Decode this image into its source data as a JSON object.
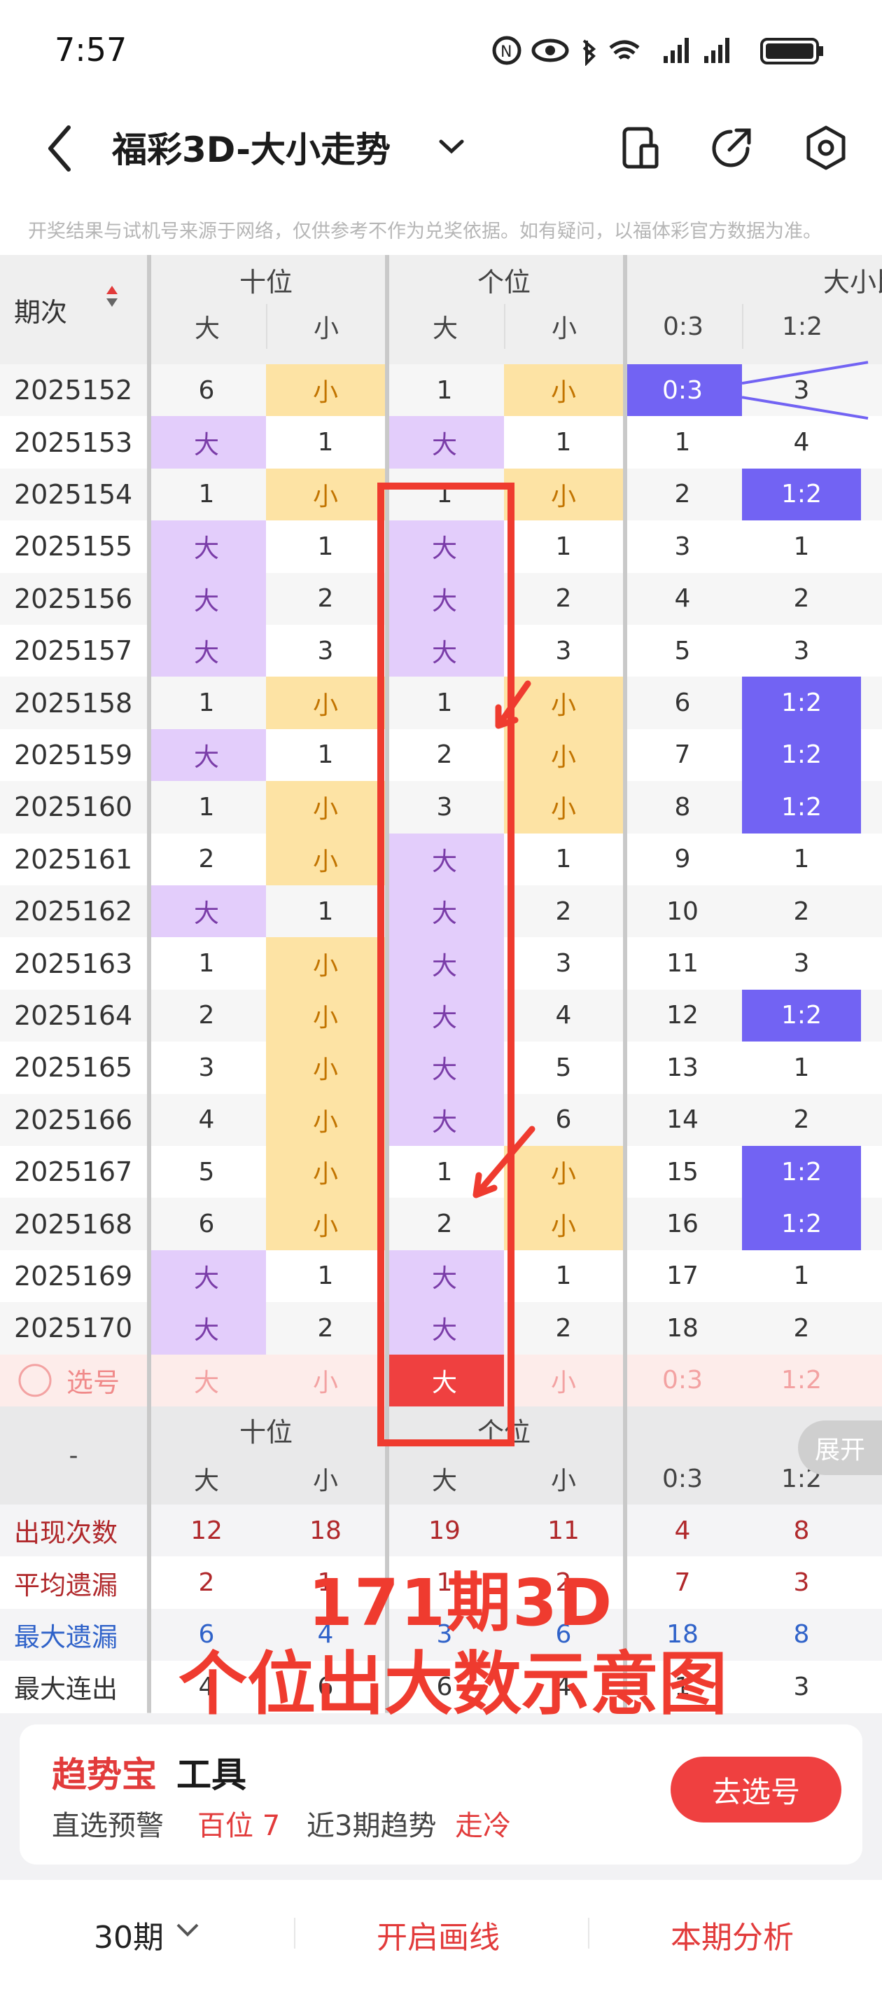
{
  "status_bar": {
    "time": "7:57",
    "icons": [
      "nfc-icon",
      "eye-icon",
      "bluetooth-icon",
      "wifi-icon",
      "signal-icon",
      "signal-icon",
      "battery-icon"
    ]
  },
  "header": {
    "title": "福彩3D-大小走势",
    "icons": [
      "back-icon",
      "chevron-down-icon",
      "phone-screen-icon",
      "share-icon",
      "settings-icon"
    ]
  },
  "disclaimer": "开奖结果与试机号来源于网络，仅供参考不作为兑奖依据。如有疑问，以福体彩官方数据为准。",
  "table": {
    "period_header": "期次",
    "groups": [
      "十位",
      "个位",
      "大小比"
    ],
    "subheaders": [
      "大",
      "小",
      "大",
      "小",
      "0:3",
      "1:2"
    ],
    "rows": [
      {
        "period": "2025152",
        "cells": [
          "6",
          "小",
          "1",
          "小",
          "0:3",
          "3"
        ]
      },
      {
        "period": "2025153",
        "cells": [
          "大",
          "1",
          "大",
          "1",
          "1",
          "4"
        ]
      },
      {
        "period": "2025154",
        "cells": [
          "1",
          "小",
          "1",
          "小",
          "2",
          "1:2"
        ]
      },
      {
        "period": "2025155",
        "cells": [
          "大",
          "1",
          "大",
          "1",
          "3",
          "1"
        ]
      },
      {
        "period": "2025156",
        "cells": [
          "大",
          "2",
          "大",
          "2",
          "4",
          "2"
        ]
      },
      {
        "period": "2025157",
        "cells": [
          "大",
          "3",
          "大",
          "3",
          "5",
          "3"
        ]
      },
      {
        "period": "2025158",
        "cells": [
          "1",
          "小",
          "1",
          "小",
          "6",
          "1:2"
        ]
      },
      {
        "period": "2025159",
        "cells": [
          "大",
          "1",
          "2",
          "小",
          "7",
          "1:2"
        ]
      },
      {
        "period": "2025160",
        "cells": [
          "1",
          "小",
          "3",
          "小",
          "8",
          "1:2"
        ]
      },
      {
        "period": "2025161",
        "cells": [
          "2",
          "小",
          "大",
          "1",
          "9",
          "1"
        ]
      },
      {
        "period": "2025162",
        "cells": [
          "大",
          "1",
          "大",
          "2",
          "10",
          "2"
        ]
      },
      {
        "period": "2025163",
        "cells": [
          "1",
          "小",
          "大",
          "3",
          "11",
          "3"
        ]
      },
      {
        "period": "2025164",
        "cells": [
          "2",
          "小",
          "大",
          "4",
          "12",
          "1:2"
        ]
      },
      {
        "period": "2025165",
        "cells": [
          "3",
          "小",
          "大",
          "5",
          "13",
          "1"
        ]
      },
      {
        "period": "2025166",
        "cells": [
          "4",
          "小",
          "大",
          "6",
          "14",
          "2"
        ]
      },
      {
        "period": "2025167",
        "cells": [
          "5",
          "小",
          "1",
          "小",
          "15",
          "1:2"
        ]
      },
      {
        "period": "2025168",
        "cells": [
          "6",
          "小",
          "2",
          "小",
          "16",
          "1:2"
        ]
      },
      {
        "period": "2025169",
        "cells": [
          "大",
          "1",
          "大",
          "1",
          "17",
          "1"
        ]
      },
      {
        "period": "2025170",
        "cells": [
          "大",
          "2",
          "大",
          "2",
          "18",
          "2"
        ]
      }
    ],
    "select_row": {
      "label": "选号",
      "cells": [
        "大",
        "小",
        "大",
        "小",
        "0:3",
        "1:2"
      ]
    },
    "footer_groups": [
      "十位",
      "个位"
    ],
    "footer_period": "-",
    "stats": [
      {
        "label": "出现次数",
        "values": [
          "12",
          "18",
          "19",
          "11",
          "4",
          "8"
        ],
        "color": "#b0282b"
      },
      {
        "label": "平均遗漏",
        "values": [
          "2",
          "1",
          "1",
          "2",
          "7",
          "3"
        ],
        "color": "#b0282b"
      },
      {
        "label": "最大遗漏",
        "values": [
          "6",
          "4",
          "3",
          "6",
          "18",
          "8"
        ],
        "color": "#2f62c9"
      },
      {
        "label": "最大连出",
        "values": [
          "4",
          "6",
          "6",
          "4",
          "1",
          "3"
        ],
        "color": "#333333"
      }
    ]
  },
  "expand_label": "展开",
  "annotation": {
    "line1": "171期3D",
    "line2": "个位出大数示意图"
  },
  "trend_card": {
    "title_red": "趋势宝",
    "title_black": "工具",
    "line_label1": "直选预警",
    "line_value1": "百位 7",
    "line_label2": "近3期趋势",
    "line_value2": "走冷",
    "button": "去选号"
  },
  "bottom_nav": {
    "periods": "30期",
    "draw_line": "开启画线",
    "analysis": "本期分析"
  },
  "colors": {
    "big_bg": "#e3cdfb",
    "small_bg": "#fde3a4",
    "ratio_bg": "#7263f3",
    "red": "#ef3b2f",
    "select_bg": "#fdecea"
  }
}
